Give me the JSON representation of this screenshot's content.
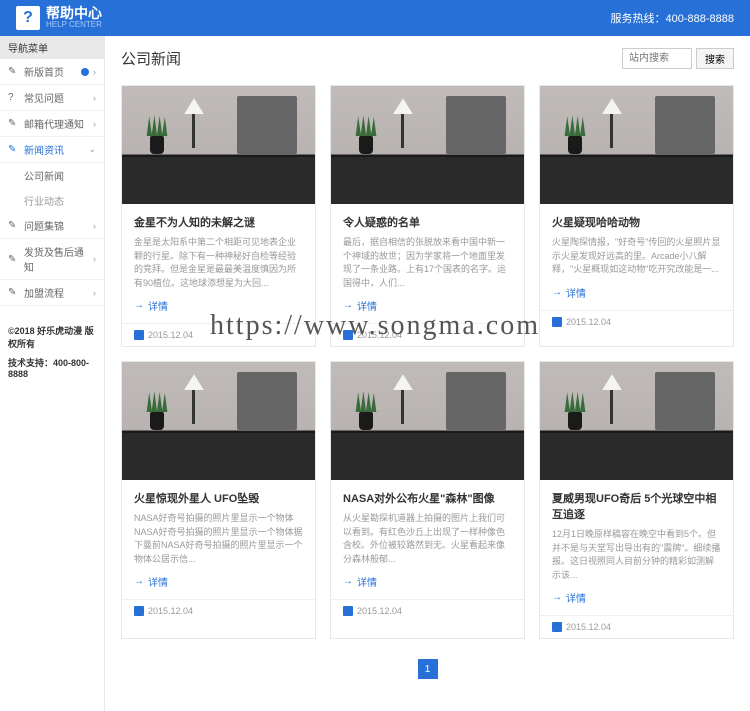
{
  "header": {
    "logo_title": "帮助中心",
    "logo_sub": "HELP CENTER",
    "hotline_label": "服务热线：",
    "hotline_number": "400-888-8888"
  },
  "sidebar": {
    "menu_title": "导航菜单",
    "items": [
      {
        "icon": "✎",
        "label": "新版首页",
        "has_radio": true
      },
      {
        "icon": "?",
        "label": "常见问题",
        "has_chevron": true
      },
      {
        "icon": "✎",
        "label": "邮箱代理通知",
        "has_chevron": true
      },
      {
        "icon": "✎",
        "label": "新闻资讯",
        "has_chevron": true,
        "active": true,
        "chevron": "⌄"
      }
    ],
    "sub_items": [
      {
        "label": "公司新闻",
        "active": true
      },
      {
        "label": "行业动态"
      }
    ],
    "items2": [
      {
        "icon": "✎",
        "label": "问题集锦",
        "has_chevron": true
      },
      {
        "icon": "✎",
        "label": "发货及售后通知",
        "has_chevron": true
      },
      {
        "icon": "✎",
        "label": "加盟流程",
        "has_chevron": true
      }
    ],
    "copyright": "©2018 好乐虎动漫 版权所有",
    "support": "技术支持：400-800-8888"
  },
  "main": {
    "page_title": "公司新闻",
    "search_placeholder": "站内搜索",
    "search_btn": "搜索"
  },
  "cards": [
    {
      "title": "金星不为人知的未解之谜",
      "desc": "金星是太阳系中第二个相距可见地表企业颗的行星。除下有一种神秘好自检等经验的竞拜。但是金星是最最美温度慎因为所有90植位。这地球添想星为大回...",
      "link": "详情",
      "date": "2015.12.04"
    },
    {
      "title": "令人疑惑的名单",
      "desc": "最后，据自相信的张脱放来看中国中新一个神域的故世；因为学家将一个地面里发现了一条业路。上有17个国表的名字。运国得中，人们...",
      "link": "详情",
      "date": "2015.12.04"
    },
    {
      "title": "火星疑现哈哈动物",
      "desc": "火星陶探情报，\"好奇号\"传回的火星照片显示火星发现好远高的里。Arcade小八解释，\"火星概现如这动物\"吃开究改能是一...",
      "link": "详情",
      "date": "2015.12.04"
    },
    {
      "title": "火星惊现外星人 UFO坠毁",
      "desc": "NASA好奇号拍摄的照片里显示一个物体NASA好奇号拍摄的照片里显示一个物体据下曼前NASA好奇号拍摄的照片里显示一个物体公居示信...",
      "link": "详情",
      "date": "2015.12.04"
    },
    {
      "title": "NASA对外公布火星\"森林\"图像",
      "desc": "从火星勘探机道器上拍摄的图片上我们可以看到。有红色沙丘上出现了一样种像色含校。外位被较路然到无。火星看起来像分森林般郁...",
      "link": "详情",
      "date": "2015.12.04"
    },
    {
      "title": "夏威男现UFO奇后 5个光球空中相互追逐",
      "desc": "12月1日晚原样稿容在晚空中看到5个。但并不是与天堂写出导出有的\"震牌\"。细续播报。这日视照同人目前分钟的精彩如测解示该...",
      "link": "详情",
      "date": "2015.12.04"
    }
  ],
  "watermark": "https://www.songma.com",
  "pagination": {
    "current": "1"
  }
}
